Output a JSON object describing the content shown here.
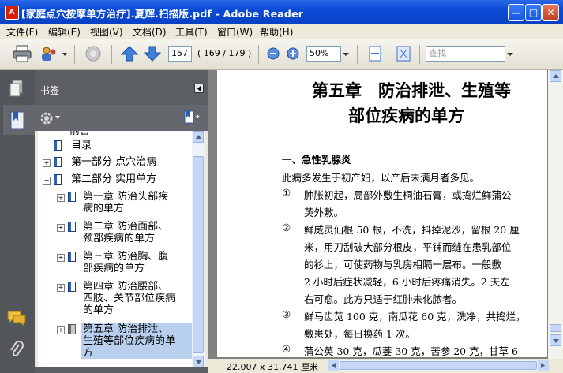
{
  "window": {
    "title": "[家庭点穴按摩单方治疗].夏辉.扫描版.pdf - Adobe Reader",
    "app_icon": "adobe-reader-icon"
  },
  "menu": [
    "文件(F)",
    "编辑(E)",
    "视图(V)",
    "文档(D)",
    "工具(T)",
    "窗口(W)",
    "帮助(H)"
  ],
  "toolbar": {
    "page_current": "157",
    "page_total": "( 169 / 179 )",
    "zoom": "50%",
    "search_placeholder": "查找"
  },
  "bookmarks": {
    "header": "书签",
    "items": [
      {
        "label": "前言",
        "partial": true
      },
      {
        "label": "目录"
      },
      {
        "label": "第一部分 点穴治病",
        "expand": "+"
      },
      {
        "label": "第二部分 实用单方",
        "expand": "-"
      },
      {
        "label_lines": [
          "第一章 防治头部疾",
          "病的单方"
        ],
        "expand": "+"
      },
      {
        "label_lines": [
          "第二章 防治面部、",
          "颈部疾病的单方"
        ],
        "expand": "+"
      },
      {
        "label_lines": [
          "第三章 防治胸、腹",
          "部疾病的单方"
        ],
        "expand": "+"
      },
      {
        "label_lines": [
          "第四章 防治腰部、",
          "四肢、关节部位疾病",
          "的单方"
        ],
        "expand": "+"
      },
      {
        "label_lines": [
          "第五章 防治排泄、",
          "生殖等部位疾病的单",
          "方"
        ],
        "expand": "+",
        "selected": true
      }
    ]
  },
  "document": {
    "chapter_line1": "第五章　防治排泄、生殖等",
    "chapter_line2": "部位疾病的单方",
    "section": "一、急性乳腺炎",
    "intro": "此病多发生于初产妇，以产后未满月者多见。",
    "items": [
      {
        "num": "①",
        "lines": [
          "肿胀初起，局部外敷生桐油石膏，或捣烂鲜蒲公",
          "英外敷。"
        ]
      },
      {
        "num": "②",
        "lines": [
          "鲜威灵仙根 50 根，不洗，抖掉泥沙，留根 20 厘",
          "米，用刀刮破大部分根皮，平铺而缝在患乳部位",
          "的衫上，可使药物与乳房相隔一层布。一般敷",
          "2 小时后症状减轻，6 小时后疼痛消失。2 天左",
          "右可愈。此方只适于红肿未化脓者。"
        ]
      },
      {
        "num": "③",
        "lines": [
          "鲜马齿苋 100 克，南瓜花 60 克，洗净，共捣烂，",
          "敷患处，每日换药 1 次。"
        ]
      },
      {
        "num": "④",
        "lines": [
          "蒲公英 30 克，瓜蒌 30 克，苦参 20 克，甘草 6"
        ]
      }
    ]
  },
  "status": {
    "page_size": "22.007 x 31.741 厘米"
  },
  "colors": {
    "titlebar": "#0a4bd6",
    "panel": "#5b5e63",
    "selection": "#b8d0ee"
  }
}
